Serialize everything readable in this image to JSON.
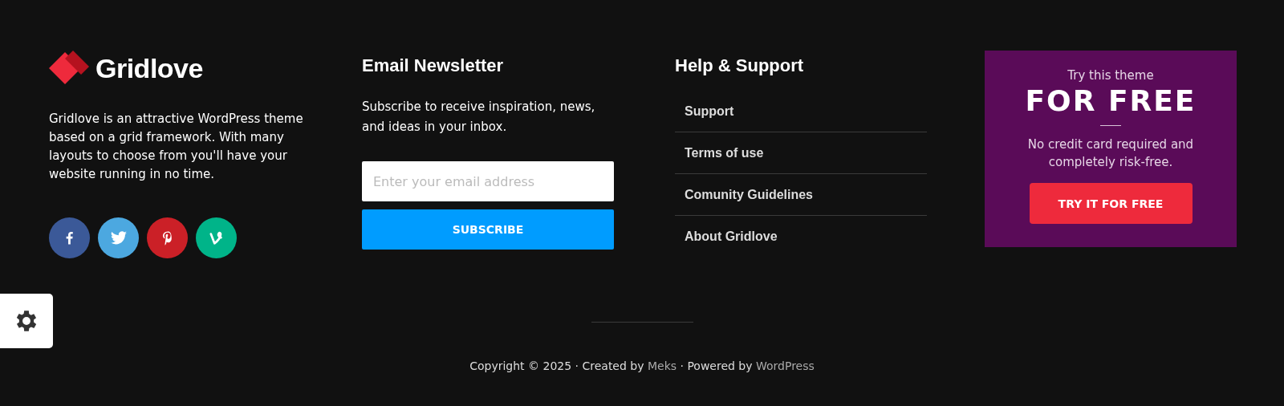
{
  "brand": {
    "name": "Gridlove",
    "description": "Gridlove is an attractive WordPress theme based on a grid framework. With many layouts to choose from you'll have your website running in no time.",
    "social": [
      {
        "kind": "facebook",
        "color": "#3b5998"
      },
      {
        "kind": "twitter",
        "color": "#4ca8e0"
      },
      {
        "kind": "pinterest",
        "color": "#cb2027"
      },
      {
        "kind": "vine",
        "color": "#00b489"
      }
    ]
  },
  "newsletter": {
    "title": "Email Newsletter",
    "text": "Subscribe to receive inspiration, news, and ideas in your inbox.",
    "placeholder": "Enter your email address",
    "button": "SUBSCRIBE"
  },
  "help": {
    "title": "Help & Support",
    "links": [
      "Support",
      "Terms of use",
      "Comunity Guidelines",
      "About Gridlove"
    ]
  },
  "promo": {
    "kicker": "Try this theme",
    "headline": "FOR FREE",
    "text": "No credit card required and completely risk-free.",
    "button": "TRY IT FOR FREE"
  },
  "copyright": {
    "prefix": "Copyright © 2025 · Created by ",
    "author": "Meks",
    "middle": " · Powered by ",
    "platform": "WordPress"
  }
}
